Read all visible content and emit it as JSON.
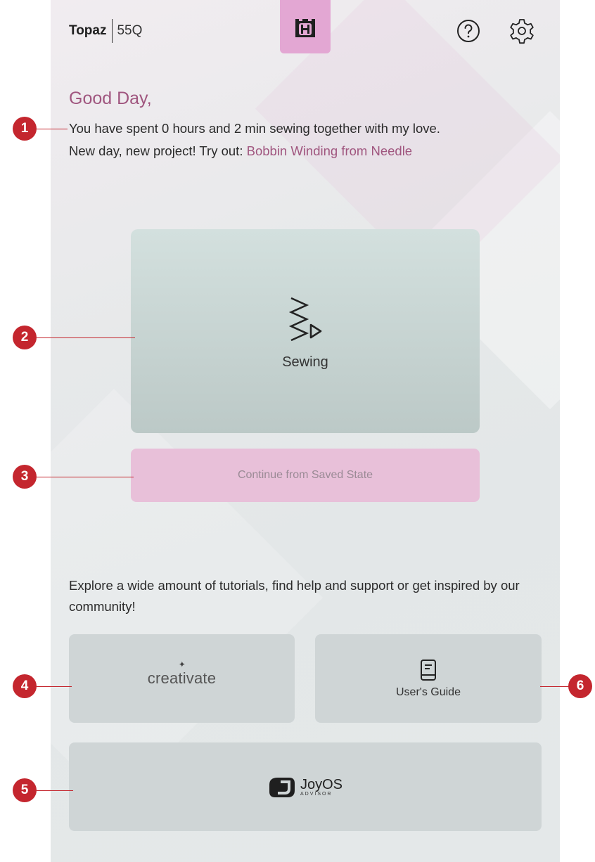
{
  "header": {
    "brand_name": "Topaz",
    "model": "55Q",
    "logo_icon": "husqvarna-crown-h-icon",
    "help_icon": "help-circle-icon",
    "settings_icon": "gear-icon",
    "logo_bg": "#e3a7d3"
  },
  "greeting": {
    "title": "Good Day,",
    "time_line": "You have spent 0 hours and 2 min sewing together with my love.",
    "suggestion_prefix": "New day, new project! Try out: ",
    "suggestion_link": "Bobbin Winding from Needle",
    "accent_color": "#a0567f"
  },
  "sewing_card": {
    "label": "Sewing",
    "icon": "zigzag-play-icon"
  },
  "continue_button": {
    "label": "Continue from Saved State",
    "bg": "#e8c0d9"
  },
  "explore_text": "Explore a wide amount of tutorials, find help and support or get inspired by our community!",
  "tiles": {
    "creativate": {
      "label": "creativate",
      "icon": "sparkle-icon"
    },
    "users_guide": {
      "label": "User's Guide",
      "icon": "book-icon"
    },
    "joyos": {
      "label": "JoyOS",
      "sublabel": "ADVISOR",
      "icon": "joyos-logo-icon"
    }
  },
  "callouts": [
    "1",
    "2",
    "3",
    "4",
    "5",
    "6"
  ],
  "callout_color": "#c4262e"
}
